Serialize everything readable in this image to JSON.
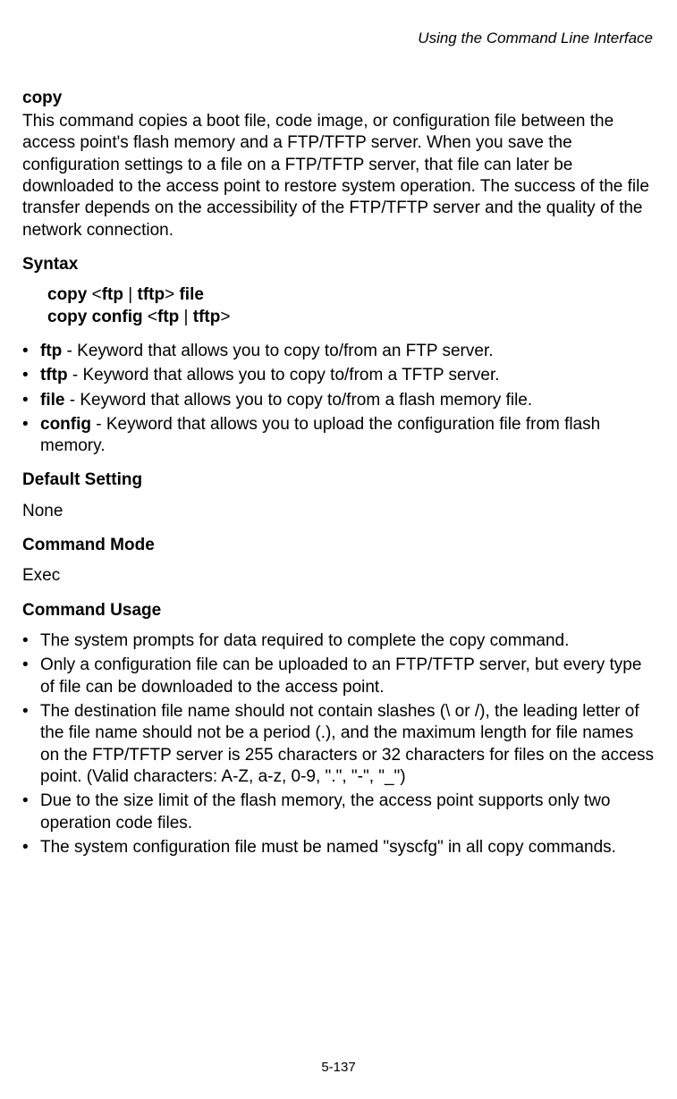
{
  "runningHead": "Using the Command Line Interface",
  "commandName": "copy",
  "description": "This command copies a boot file, code image, or configuration file between the access point's flash memory and a FTP/TFTP server. When you save the configuration settings to a file on a FTP/TFTP server, that file can later be downloaded to the access point to restore system operation. The success of the file transfer depends on the accessibility of the FTP/TFTP server and the quality of the network connection.",
  "syntax": {
    "heading": "Syntax",
    "line1": {
      "pre": "copy ",
      "lt1": "<",
      "kw1": "ftp",
      "pipe": " | ",
      "kw2": "tftp",
      "gt1": "> ",
      "kw3": "file"
    },
    "line2": {
      "pre": "copy config ",
      "lt1": "<",
      "kw1": "ftp",
      "pipe": " | ",
      "kw2": "tftp",
      "gt1": ">"
    },
    "params": [
      {
        "kw": "ftp",
        "desc": " - Keyword that allows you to copy to/from an FTP server."
      },
      {
        "kw": "tftp",
        "desc": " - Keyword that allows you to copy to/from a TFTP server."
      },
      {
        "kw": "file",
        "desc": " - Keyword that allows you to copy to/from a flash memory file."
      },
      {
        "kw": "config",
        "desc": " - Keyword that allows you to upload the configuration file from flash memory."
      }
    ]
  },
  "defaultSetting": {
    "heading": "Default Setting",
    "value": "None"
  },
  "commandMode": {
    "heading": "Command Mode",
    "value": "Exec"
  },
  "commandUsage": {
    "heading": "Command Usage",
    "items": [
      "The system prompts for data required to complete the copy command.",
      "Only a configuration file can be uploaded to an FTP/TFTP server, but every type of file can be downloaded to the access point.",
      "The destination file name should not contain slashes (\\ or /), the leading letter of the file name should not be a period (.), and the maximum length for file names on the FTP/TFTP server is 255 characters or 32 characters for files on the access point. (Valid characters: A-Z, a-z, 0-9, \".\", \"-\", \"_\")",
      "Due to the size limit of the flash memory, the access point supports only two operation code files.",
      "The system configuration file must be named \"syscfg\" in all copy commands."
    ]
  },
  "pageNumber": "5-137"
}
